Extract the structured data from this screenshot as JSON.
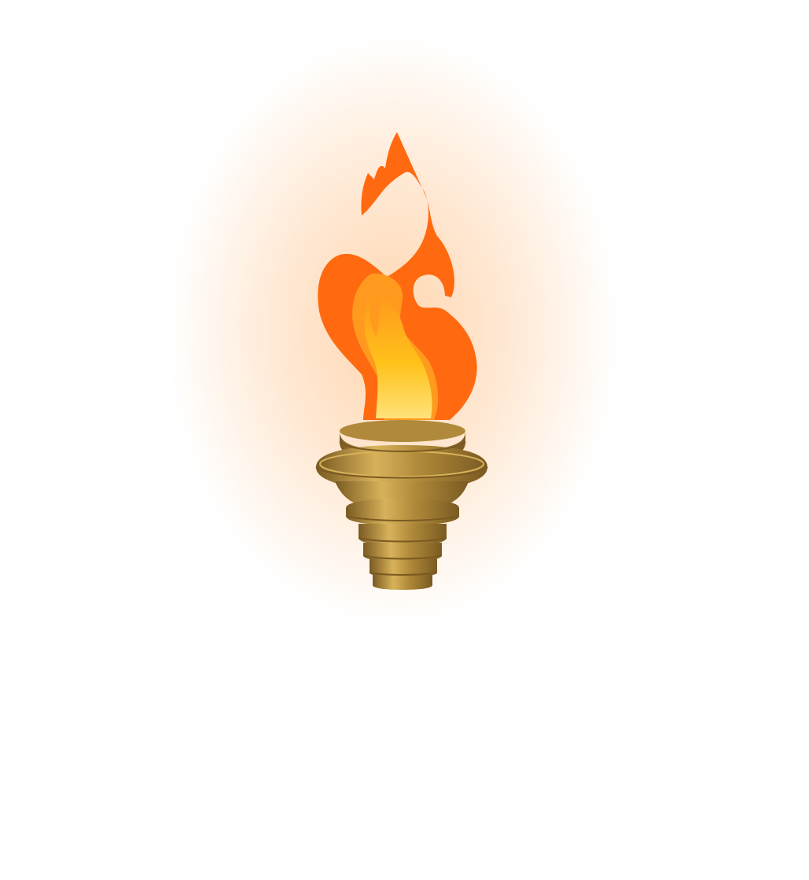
{
  "illustration": {
    "subject": "flaming-torch-icon",
    "colors": {
      "background": "#ffffff",
      "glow": "#ffd6b0",
      "flame_outer": "#ff6a10",
      "flame_mid": "#ff9a1e",
      "flame_inner": "#ffc21a",
      "flame_core": "#ffe27a",
      "bronze_light": "#d8b25a",
      "bronze_mid": "#b08a3a",
      "bronze_dark": "#7a5a22"
    }
  }
}
